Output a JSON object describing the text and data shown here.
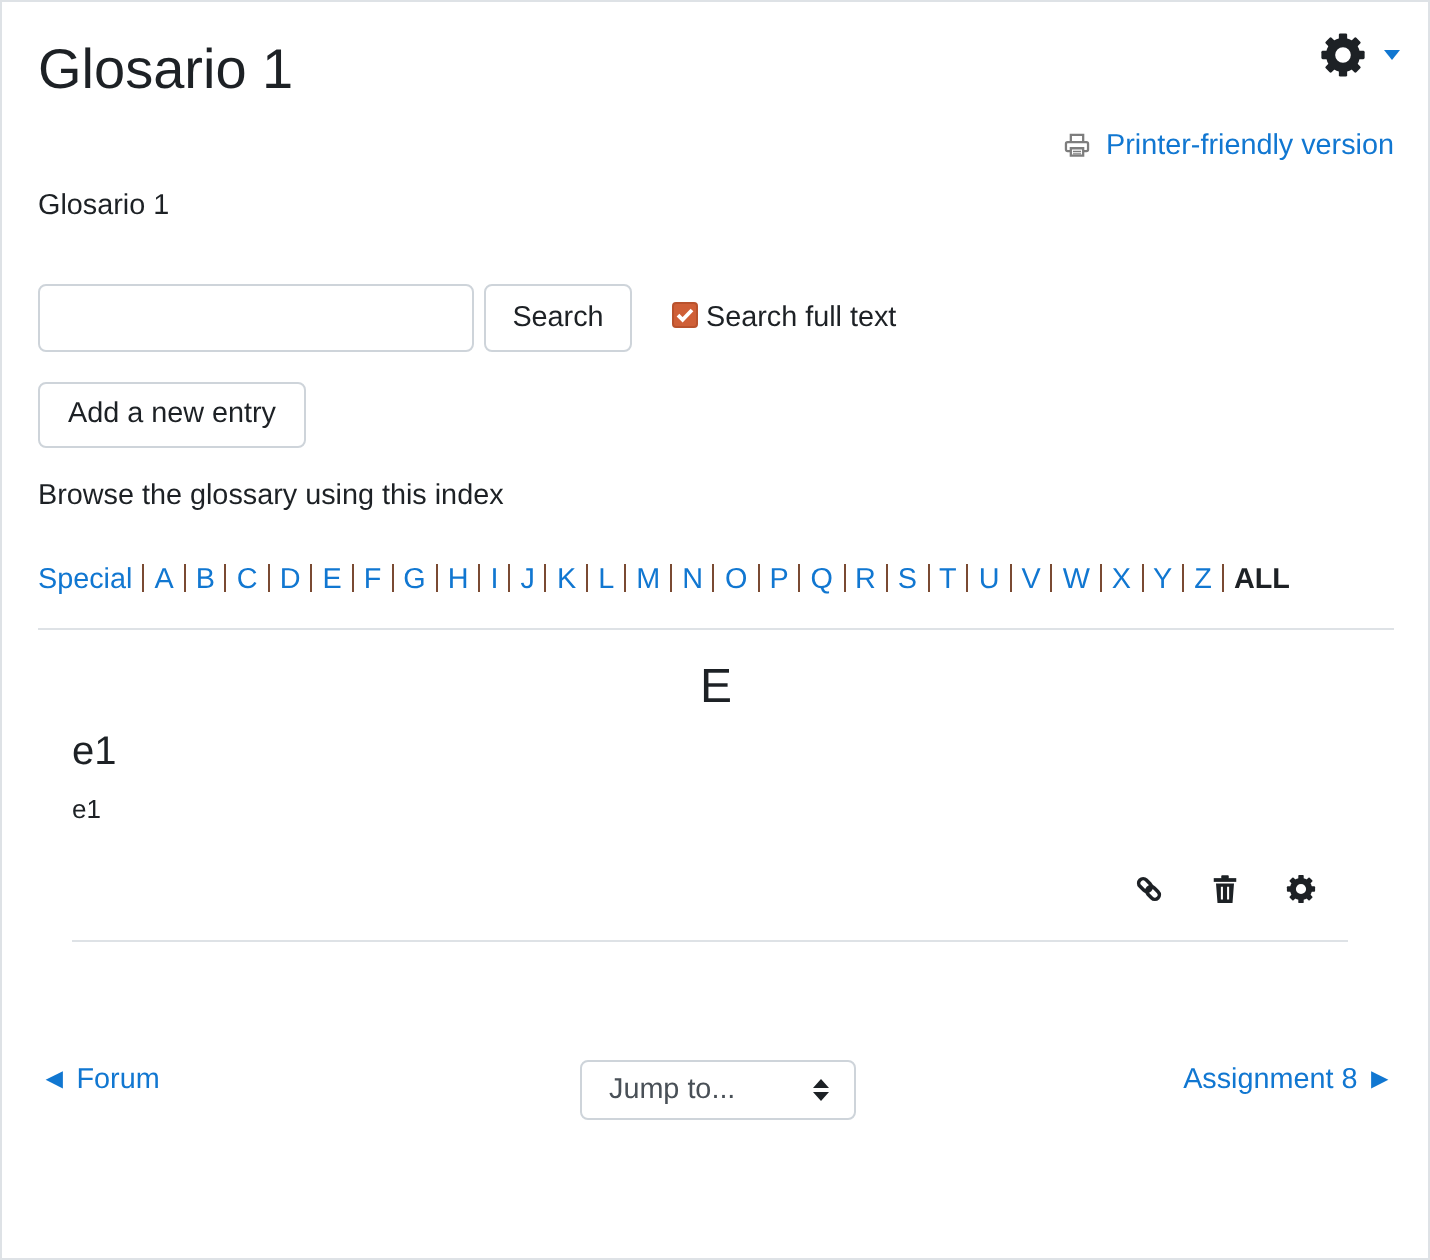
{
  "page": {
    "title": "Glosario 1",
    "printer_link": "Printer-friendly version",
    "description": "Glosario 1"
  },
  "search": {
    "button": "Search",
    "full_text": {
      "label": "Search full text",
      "checked": true
    }
  },
  "add_entry_button": "Add a new entry",
  "index": {
    "caption": "Browse the glossary using this index",
    "letters": [
      {
        "label": "Special",
        "selected": false
      },
      {
        "label": "A",
        "selected": false
      },
      {
        "label": "B",
        "selected": false
      },
      {
        "label": "C",
        "selected": false
      },
      {
        "label": "D",
        "selected": false
      },
      {
        "label": "E",
        "selected": false
      },
      {
        "label": "F",
        "selected": false
      },
      {
        "label": "G",
        "selected": false
      },
      {
        "label": "H",
        "selected": false
      },
      {
        "label": "I",
        "selected": false
      },
      {
        "label": "J",
        "selected": false
      },
      {
        "label": "K",
        "selected": false
      },
      {
        "label": "L",
        "selected": false
      },
      {
        "label": "M",
        "selected": false
      },
      {
        "label": "N",
        "selected": false
      },
      {
        "label": "O",
        "selected": false
      },
      {
        "label": "P",
        "selected": false
      },
      {
        "label": "Q",
        "selected": false
      },
      {
        "label": "R",
        "selected": false
      },
      {
        "label": "S",
        "selected": false
      },
      {
        "label": "T",
        "selected": false
      },
      {
        "label": "U",
        "selected": false
      },
      {
        "label": "V",
        "selected": false
      },
      {
        "label": "W",
        "selected": false
      },
      {
        "label": "X",
        "selected": false
      },
      {
        "label": "Y",
        "selected": false
      },
      {
        "label": "Z",
        "selected": false
      },
      {
        "label": "ALL",
        "selected": true
      }
    ]
  },
  "entries": {
    "group_heading": "E",
    "items": [
      {
        "concept": "e1",
        "definition": "e1"
      }
    ]
  },
  "navigation": {
    "previous": "◄ Forum",
    "jump_select": "Jump to...",
    "next": "Assignment 8 ►"
  }
}
